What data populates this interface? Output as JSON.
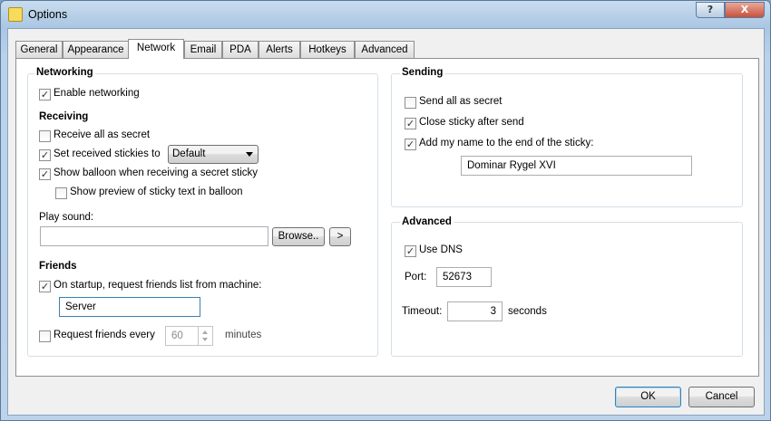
{
  "window": {
    "title": "Options"
  },
  "tabs": [
    "General",
    "Appearance",
    "Network",
    "Email",
    "PDA",
    "Alerts",
    "Hotkeys",
    "Advanced"
  ],
  "active_tab": "Network",
  "networking": {
    "heading": "Networking",
    "enable_networking": {
      "label": "Enable networking",
      "checked": true
    }
  },
  "receiving": {
    "heading": "Receiving",
    "receive_all_secret": {
      "label": "Receive all as secret",
      "checked": false
    },
    "set_received_stickies": {
      "label": "Set received stickies to",
      "checked": true,
      "value": "Default"
    },
    "show_balloon": {
      "label": "Show balloon when receiving a secret sticky",
      "checked": true
    },
    "show_preview": {
      "label": "Show preview of sticky text in balloon",
      "checked": false
    },
    "play_sound_label": "Play sound:",
    "play_sound_value": "",
    "browse_label": "Browse..",
    "test_label": ">"
  },
  "friends": {
    "heading": "Friends",
    "on_startup": {
      "label": "On startup, request friends list from machine:",
      "checked": true
    },
    "machine_value": "Server",
    "request_every": {
      "label": "Request friends every",
      "checked": false,
      "value": "60",
      "unit": "minutes"
    }
  },
  "sending": {
    "heading": "Sending",
    "send_all_secret": {
      "label": "Send all as secret",
      "checked": false
    },
    "close_after_send": {
      "label": "Close sticky after send",
      "checked": true
    },
    "add_name": {
      "label": "Add my name to the end of the sticky:",
      "checked": true
    },
    "name_value": "Dominar Rygel XVI"
  },
  "advanced": {
    "heading": "Advanced",
    "use_dns": {
      "label": "Use DNS",
      "checked": true
    },
    "port_label": "Port:",
    "port_value": "52673",
    "timeout_label": "Timeout:",
    "timeout_value": "3",
    "timeout_unit": "seconds"
  },
  "footer": {
    "ok_label": "OK",
    "cancel_label": "Cancel"
  },
  "icons": {
    "check": "✓",
    "help": "?",
    "close": "X",
    "arrow_down": "chevron-down-icon"
  },
  "colors": {
    "accent": "#3c7fb1",
    "titlebar": "#bcd3ea"
  }
}
